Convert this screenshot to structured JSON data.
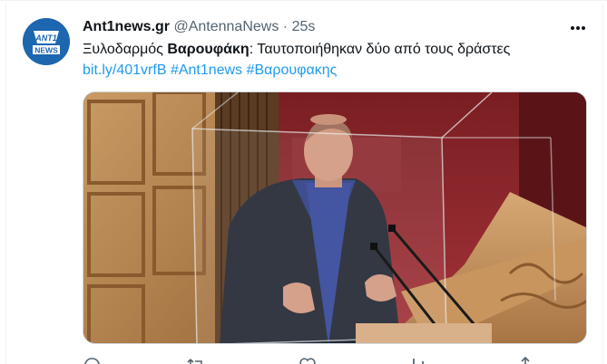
{
  "tweet": {
    "display_name": "Ant1news.gr",
    "handle": "@AntennaNews",
    "separator": "·",
    "time": "25s",
    "text_prefix": "Ξυλοδαρμός ",
    "text_bold": "Βαρουφάκη",
    "text_suffix": ": Ταυτοποιήθηκαν δύο από τους δράστες",
    "link": "bit.ly/401vrfB",
    "hashtag_1": "#Ant1news",
    "hashtag_2": "#Βαρουφακης"
  },
  "avatar": {
    "logo_top": "ANT1",
    "logo_bottom": "NEWS"
  },
  "icons": [
    "more-icon",
    "reply-icon",
    "retweet-icon",
    "like-icon",
    "views-icon",
    "share-icon"
  ],
  "colors": {
    "link": "#1d9bf0",
    "text": "#0f1419",
    "secondary": "#536471",
    "brand": "#1d66b0"
  }
}
